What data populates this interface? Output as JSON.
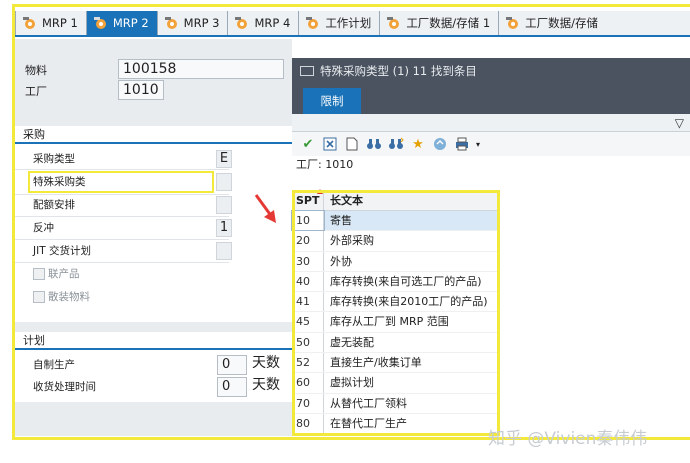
{
  "tabs": [
    {
      "label": "MRP 1",
      "active": false
    },
    {
      "label": "MRP 2",
      "active": true
    },
    {
      "label": "MRP 3",
      "active": false
    },
    {
      "label": "MRP 4",
      "active": false
    },
    {
      "label": "工作计划",
      "active": false
    },
    {
      "label": "工厂数据/存储 1",
      "active": false
    },
    {
      "label": "工厂数据/存储",
      "active": false
    }
  ],
  "header": {
    "material_label": "物料",
    "material_value": "100158",
    "plant_label": "工厂",
    "plant_value": "1010"
  },
  "procurement": {
    "title": "采购",
    "type_label": "采购类型",
    "type_value": "E",
    "special_label": "特殊采购类",
    "special_value": "",
    "quota_label": "配额安排",
    "backflush_label": "反冲",
    "backflush_value": "1",
    "jit_label": "JIT 交货计划",
    "coproduct_label": "联产品",
    "bulk_label": "散装物料"
  },
  "scheduling": {
    "title": "计划",
    "inhouse_label": "自制生产",
    "inhouse_value": "0",
    "inhouse_unit": "天数",
    "gr_label": "收货处理时间",
    "gr_value": "0",
    "gr_unit": "天数"
  },
  "dialog": {
    "title": "特殊采购类型 (1)   11 找到条目",
    "tab_label": "限制",
    "plant_line": "工厂: 1010",
    "col_key": "SPT",
    "col_text": "长文本",
    "rows": [
      {
        "key": "10",
        "text": "寄售"
      },
      {
        "key": "20",
        "text": "外部采购"
      },
      {
        "key": "30",
        "text": "外协"
      },
      {
        "key": "40",
        "text": "库存转换(来自可选工厂的产品)"
      },
      {
        "key": "41",
        "text": "库存转换(来自2010工厂的产品)"
      },
      {
        "key": "45",
        "text": "库存从工厂到 MRP 范围"
      },
      {
        "key": "50",
        "text": "虚无装配"
      },
      {
        "key": "52",
        "text": "直接生产/收集订单"
      },
      {
        "key": "60",
        "text": "虚拟计划"
      },
      {
        "key": "70",
        "text": "从替代工厂领料"
      },
      {
        "key": "80",
        "text": "在替代工厂生产"
      }
    ]
  },
  "watermark": "知乎 @Vivien秦伟伟",
  "colors": {
    "accent": "#1a73b8",
    "highlight": "#f3e93a",
    "arrow": "#e53935"
  }
}
